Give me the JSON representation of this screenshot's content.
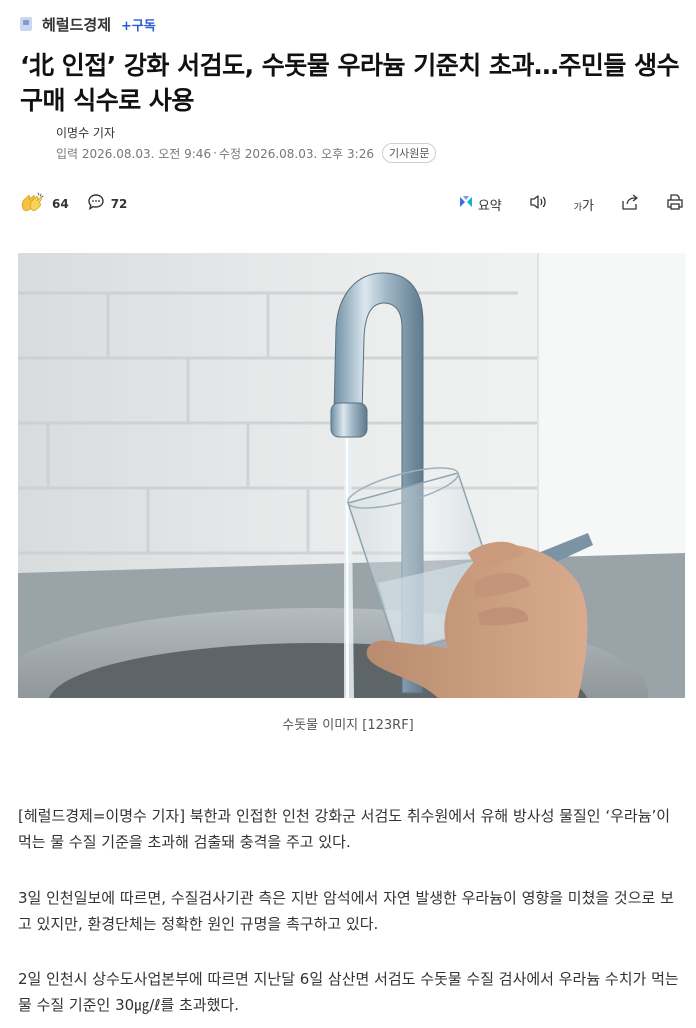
{
  "press": {
    "name": "헤럴드경제",
    "subscribe_label": "+구독"
  },
  "article": {
    "headline": "‘北 인접’ 강화 서검도, 수돗물 우라늄 기준치 초과…주민들 생수 구매 식수로 사용",
    "reporter": "이명수 기자",
    "published": "입력 2026.08.03. 오전 9:46",
    "modified": "수정 2026.08.03. 오후 3:26",
    "meta_separator": "·",
    "origin_label": "기사원문",
    "image_caption": "수돗물 이미지 [123RF]",
    "paragraphs": [
      "[헤럴드경제=이명수 기자] 북한과 인접한 인천 강화군 서검도 취수원에서 유해 방사성 물질인 ‘우라늄’이 먹는 물 수질 기준을 초과해 검출돼 충격을 주고 있다.",
      "3일 인천일보에 따르면, 수질검사기관 측은 지반 암석에서 자연 발생한 우라늄이 영향을 미쳤을 것으로 보고 있지만, 환경단체는 정확한 원인 규명을 촉구하고 있다.",
      "2일 인천시 상수도사업본부에 따르면 지난달 6일 삼산면 서검도 수돗물 수질 검사에서 우라늄 수치가 먹는 물 수질 기준인 30㎍/ℓ를 초과했다."
    ]
  },
  "actions": {
    "reaction_count": "64",
    "comment_count": "72",
    "summary_label": "요약",
    "font_size_label": "가"
  },
  "icons": {
    "reaction": "clap-hands-icon",
    "comment": "speech-bubble-icon",
    "summary": "ai-summary-icon",
    "audio": "speaker-icon",
    "font_size": "font-size-icon",
    "share": "share-icon",
    "print": "print-icon"
  },
  "colors": {
    "accent": "#2a5bd7",
    "headline": "#111111",
    "body_text": "#333333",
    "meta_text": "#777777"
  }
}
